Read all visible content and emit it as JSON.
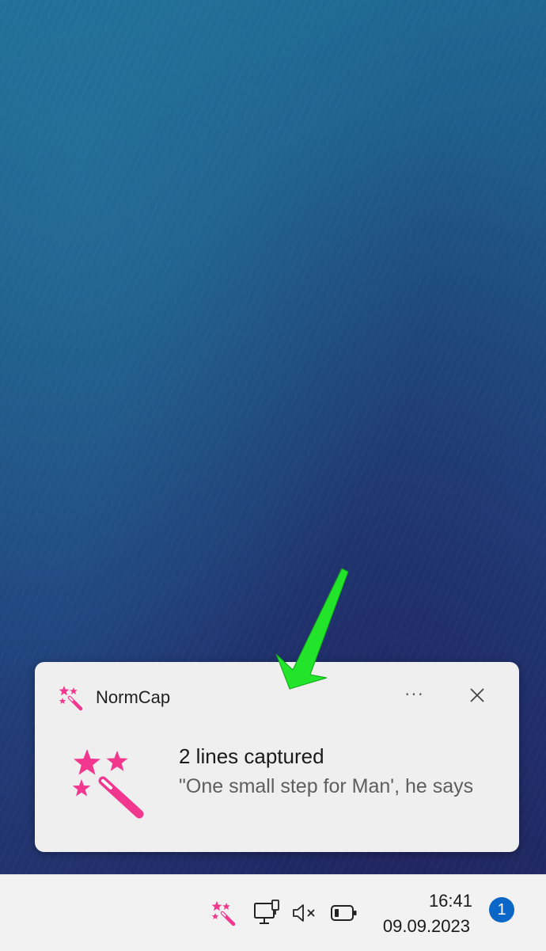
{
  "notification": {
    "app_name": "NormCap",
    "more_label": "···",
    "title": "2 lines captured",
    "body": "\"One small step for Man', he says",
    "icon": "magic-wand-icon"
  },
  "taskbar": {
    "time": "16:41",
    "date": "09.09.2023",
    "notification_count": "1",
    "tray_icons": [
      "normcap-tray-icon",
      "network-icon",
      "volume-muted-icon",
      "battery-icon"
    ]
  },
  "colors": {
    "accent_pink": "#f2378f",
    "arrow_green": "#22e42a",
    "badge_blue": "#0a67c8",
    "toast_bg": "#efefef",
    "taskbar_bg": "#f2f2f2"
  }
}
